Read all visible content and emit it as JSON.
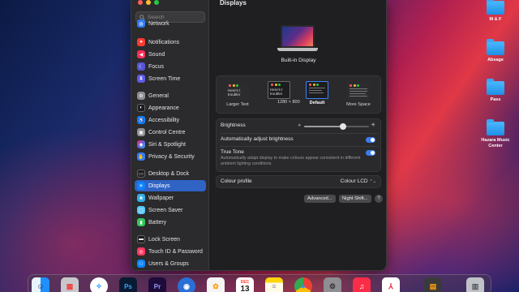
{
  "sidebar": {
    "search_placeholder": "Search",
    "items": [
      {
        "label": "Network",
        "icon": "globe-icon",
        "color": "#2f7bf5"
      },
      {
        "label": "Notifications",
        "icon": "bell-icon",
        "color": "#ff3b30"
      },
      {
        "label": "Sound",
        "icon": "speaker-icon",
        "color": "#ff2d55"
      },
      {
        "label": "Focus",
        "icon": "moon-icon",
        "color": "#5856d6"
      },
      {
        "label": "Screen Time",
        "icon": "hourglass-icon",
        "color": "#5e5ce6"
      },
      {
        "label": "General",
        "icon": "gear-icon",
        "color": "#8e8e93"
      },
      {
        "label": "Appearance",
        "icon": "appearance-icon",
        "color": "#1c1c1e"
      },
      {
        "label": "Accessibility",
        "icon": "accessibility-icon",
        "color": "#0a84ff"
      },
      {
        "label": "Control Centre",
        "icon": "control-centre-icon",
        "color": "#8e8e93"
      },
      {
        "label": "Siri & Spotlight",
        "icon": "siri-icon",
        "color": "#af52de"
      },
      {
        "label": "Privacy & Security",
        "icon": "hand-icon",
        "color": "#2f7bf5"
      },
      {
        "label": "Desktop & Dock",
        "icon": "dock-icon",
        "color": "#1c1c1e"
      },
      {
        "label": "Displays",
        "icon": "sun-icon",
        "color": "#0a84ff"
      },
      {
        "label": "Wallpaper",
        "icon": "wallpaper-icon",
        "color": "#32ade6"
      },
      {
        "label": "Screen Saver",
        "icon": "screen-saver-icon",
        "color": "#5ac8fa"
      },
      {
        "label": "Battery",
        "icon": "battery-icon",
        "color": "#34c759"
      },
      {
        "label": "Lock Screen",
        "icon": "lock-icon",
        "color": "#1c1c1e"
      },
      {
        "label": "Touch ID & Password",
        "icon": "fingerprint-icon",
        "color": "#ff375f"
      },
      {
        "label": "Users & Groups",
        "icon": "users-icon",
        "color": "#0a84ff"
      }
    ],
    "active_item": "Displays"
  },
  "main": {
    "title": "Displays",
    "display_name": "Built-in Display",
    "resolution": {
      "options": [
        {
          "label": "Larger Text",
          "thumb_text": "Here's t troubler"
        },
        {
          "label": "",
          "thumb_text": "Here's t troubler"
        },
        {
          "label": "Default"
        },
        {
          "label": "More Space"
        }
      ],
      "current_value": "1280 × 800",
      "selected": "Default"
    },
    "brightness": {
      "label": "Brightness",
      "level": 0.6
    },
    "auto_brightness": {
      "label": "Automatically adjust brightness",
      "enabled": true
    },
    "true_tone": {
      "label": "True Tone",
      "description": "Automatically adapt display to make colours appear consistent in different ambient lighting conditions.",
      "enabled": true
    },
    "colour_profile": {
      "label": "Colour profile",
      "value": "Colour LCD",
      "chevron": "⌃⌄"
    },
    "buttons": {
      "advanced": "Advanced...",
      "night_shift": "Night Shift...",
      "help": "?"
    }
  },
  "desktop": {
    "folders": [
      {
        "label": "M & F"
      },
      {
        "label": "Absage"
      },
      {
        "label": "Pass"
      },
      {
        "label": "Hazara Music Center"
      }
    ]
  },
  "dock": {
    "calendar_month": "DEC",
    "calendar_day": "13",
    "apps": [
      {
        "name": "finder-icon",
        "color": "#1e90ff",
        "glyph": "☺"
      },
      {
        "name": "launchpad-icon",
        "color": "#c8c8cc",
        "glyph": "▦"
      },
      {
        "name": "safari-icon",
        "color": "#1a8cff",
        "glyph": "✧"
      },
      {
        "name": "photoshop-icon",
        "color": "#0b1a33",
        "glyph": "Ps"
      },
      {
        "name": "premiere-icon",
        "color": "#1e0b3a",
        "glyph": "Pr"
      },
      {
        "name": "camera-app-icon",
        "color": "#2a6fd6",
        "glyph": "◉"
      },
      {
        "name": "photos-icon",
        "color": "#f4f4f4",
        "glyph": "✿"
      },
      {
        "name": "calendar-icon",
        "color": "#ffffff",
        "glyph": ""
      },
      {
        "name": "notes-icon",
        "color": "#ffd60a",
        "glyph": "≡"
      },
      {
        "name": "chrome-icon",
        "color": "#ffffff",
        "glyph": "◎"
      },
      {
        "name": "system-settings-icon",
        "color": "#8e8e93",
        "glyph": "⚙"
      },
      {
        "name": "music-icon",
        "color": "#fa2d48",
        "glyph": "♫"
      },
      {
        "name": "acrobat-icon",
        "color": "#ffffff",
        "glyph": "⅄"
      },
      {
        "name": "calculator-icon",
        "color": "#3a3a3c",
        "glyph": "▤"
      },
      {
        "name": "trash-icon",
        "color": "#bfc3c8",
        "glyph": "▥"
      }
    ]
  }
}
